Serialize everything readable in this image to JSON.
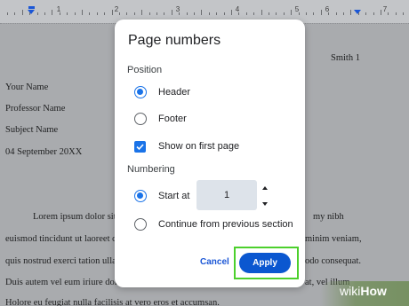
{
  "ruler": {
    "numbers": [
      "1",
      "2",
      "3",
      "4",
      "5",
      "6",
      "7"
    ]
  },
  "document": {
    "header_text": "Smith 1",
    "lines": [
      "Your Name",
      "Professor Name",
      "Subject Name",
      "04 September 20XX"
    ],
    "body_left": [
      "Lorem ipsum dolor sit",
      "euismod tincidunt ut laoreet d",
      "quis nostrud exerci tation ullan",
      "Duis autem vel eum iriure dolo",
      "Holore eu feugiat nulla facilisis at vero eros et accumsan."
    ],
    "body_right": [
      "my nibh",
      "minim veniam,",
      "odo consequat.",
      "at, vel illum"
    ]
  },
  "dialog": {
    "title": "Page numbers",
    "position_label": "Position",
    "options": {
      "header": "Header",
      "footer": "Footer",
      "show_first": "Show on first page"
    },
    "numbering_label": "Numbering",
    "start_at_label": "Start at",
    "start_value": "1",
    "continue_label": "Continue from previous section",
    "cancel_label": "Cancel",
    "apply_label": "Apply",
    "selected_position": "Header",
    "selected_numbering": "Start at",
    "show_on_first_page": true
  },
  "watermark": {
    "part1": "wiki",
    "part2": "How"
  },
  "colors": {
    "accent": "#1a73e8",
    "apply_button": "#0b57d0",
    "highlight_outline": "#4cd02c"
  }
}
